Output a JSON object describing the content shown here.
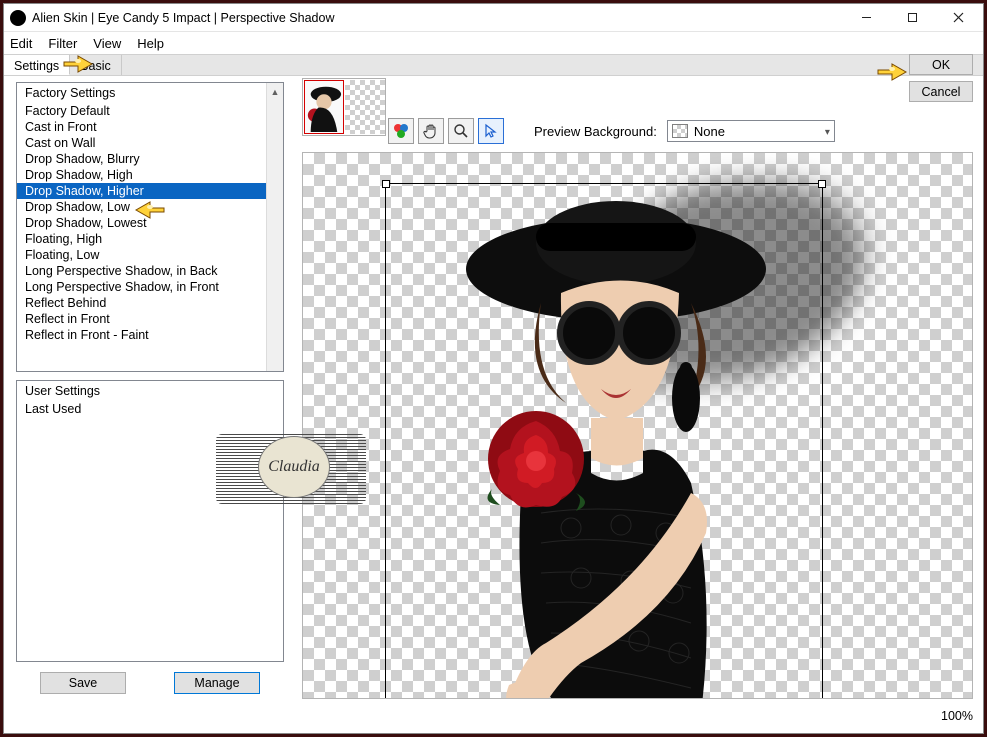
{
  "window": {
    "title": "Alien Skin | Eye Candy 5 Impact | Perspective Shadow"
  },
  "menubar": [
    "Edit",
    "Filter",
    "View",
    "Help"
  ],
  "tabs": {
    "settings": "Settings",
    "basic": "Basic"
  },
  "dialog": {
    "ok": "OK",
    "cancel": "Cancel"
  },
  "factory": {
    "header": "Factory Settings",
    "items": [
      "Factory Default",
      "Cast in Front",
      "Cast on Wall",
      "Drop Shadow, Blurry",
      "Drop Shadow, High",
      "Drop Shadow, Higher",
      "Drop Shadow, Low",
      "Drop Shadow, Lowest",
      "Floating, High",
      "Floating, Low",
      "Long Perspective Shadow, in Back",
      "Long Perspective Shadow, in Front",
      "Reflect Behind",
      "Reflect in Front",
      "Reflect in Front - Faint"
    ],
    "selected_index": 5
  },
  "user": {
    "header": "User Settings",
    "items": [
      "Last Used"
    ]
  },
  "panel_buttons": {
    "save": "Save",
    "manage": "Manage"
  },
  "preview": {
    "bg_label": "Preview Background:",
    "bg_value": "None",
    "zoom": "100%"
  },
  "watermark": "Claudia"
}
